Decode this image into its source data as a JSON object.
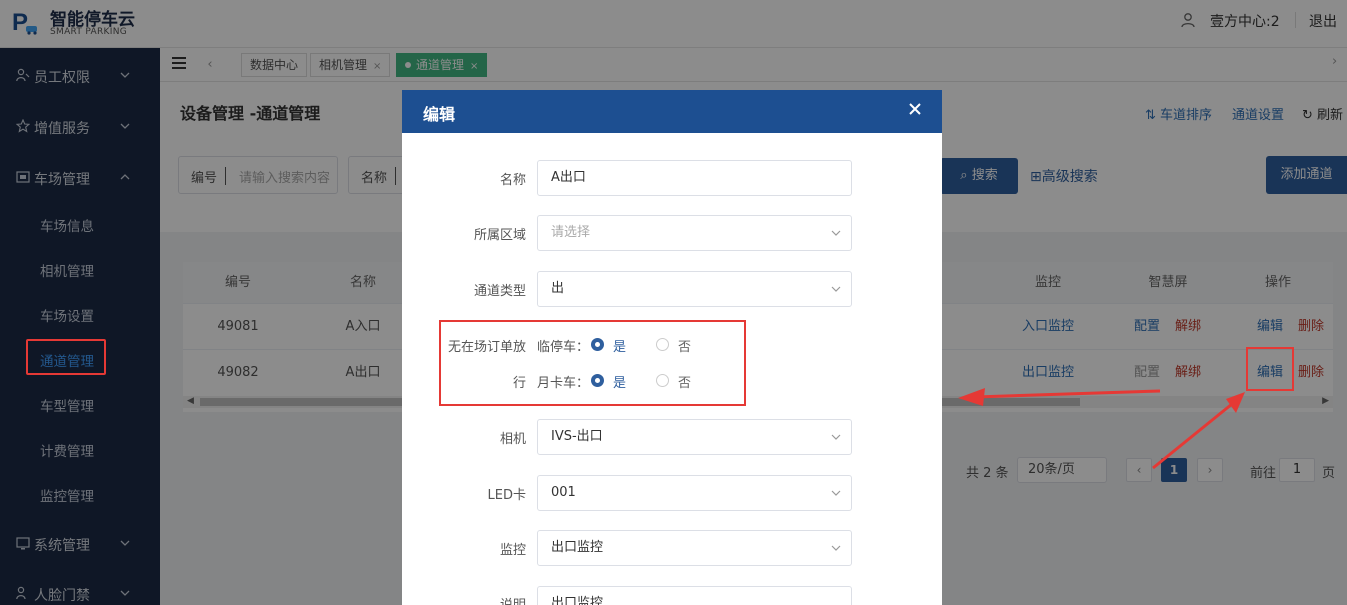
{
  "header": {
    "app_title": "智能停车云",
    "app_subtitle": "SMART PARKING",
    "user_name": "壹方中心:2",
    "logout": "退出"
  },
  "sidebar": {
    "groups": [
      {
        "label": "员工权限"
      },
      {
        "label": "增值服务"
      },
      {
        "label": "车场管理"
      },
      {
        "label": "系统管理"
      },
      {
        "label": "人脸门禁"
      }
    ],
    "items": [
      {
        "label": "车场信息"
      },
      {
        "label": "相机管理"
      },
      {
        "label": "车场设置"
      },
      {
        "label": "通道管理"
      },
      {
        "label": "车型管理"
      },
      {
        "label": "计费管理"
      },
      {
        "label": "监控管理"
      }
    ]
  },
  "tabs": [
    {
      "label": "数据中心"
    },
    {
      "label": "相机管理",
      "close": "×"
    },
    {
      "label": "通道管理",
      "close": "×"
    }
  ],
  "page": {
    "title": "设备管理 -通道管理",
    "lane_sort": "车道排序",
    "lane_settings": "通道设置",
    "refresh": "刷新"
  },
  "search": {
    "number_label": "编号",
    "number_placeholder": "请输入搜索内容",
    "name_label": "名称",
    "search_button": "搜索",
    "advanced": "高级搜索",
    "add_button": "添加通道"
  },
  "table": {
    "headers": {
      "number": "编号",
      "name": "名称",
      "monitor": "监控",
      "screen": "智慧屏",
      "action": "操作"
    },
    "rows": [
      {
        "number": "49081",
        "name": "A入口",
        "monitor": "入口监控",
        "config": "配置",
        "unbind": "解绑",
        "edit": "编辑",
        "delete": "删除"
      },
      {
        "number": "49082",
        "name": "A出口",
        "monitor": "出口监控",
        "config": "配置",
        "unbind": "解绑",
        "edit": "编辑",
        "delete": "删除"
      }
    ]
  },
  "pagination": {
    "total": "共 2 条",
    "page_size": "20条/页",
    "current": "1",
    "goto_label": "前往",
    "goto_value": "1",
    "page_suffix": "页"
  },
  "modal": {
    "title": "编辑",
    "fields": {
      "name_label": "名称",
      "name_value": "A出口",
      "area_label": "所属区域",
      "area_placeholder": "请选择",
      "type_label": "通道类型",
      "type_value": "出",
      "no_order_label_1": "无在场订单放",
      "no_order_label_2": "行",
      "temp_car_label": "临停车：",
      "monthly_car_label": "月卡车：",
      "yes": "是",
      "no": "否",
      "camera_label": "相机",
      "camera_value": "IVS-出口",
      "led_label": "LED卡",
      "led_value": "001",
      "monitor_label": "监控",
      "monitor_value": "出口监控",
      "desc_label": "说明",
      "desc_value": "出口监控"
    }
  },
  "colors": {
    "sidebar_bg": "#1c2b45",
    "primary": "#2f5f9e",
    "modal_header": "#1d4f91",
    "active_tab": "#42b983",
    "annotation_red": "#e53935"
  }
}
